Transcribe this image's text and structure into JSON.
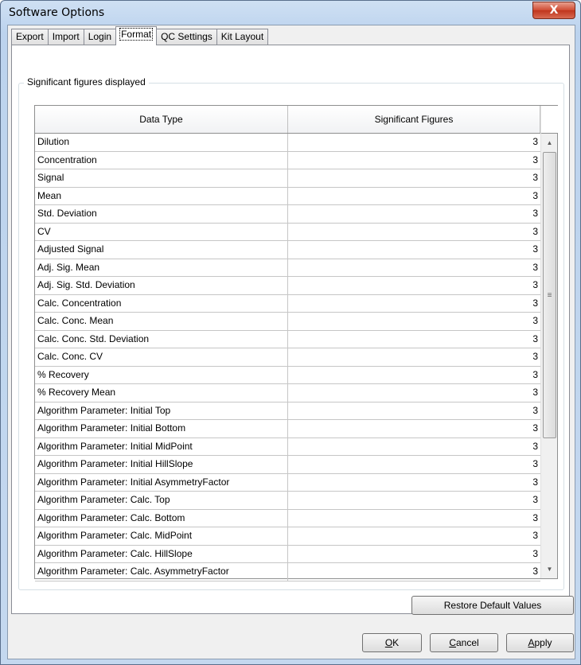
{
  "window": {
    "title": "Software Options",
    "close_label": "X"
  },
  "tabs": [
    {
      "label": "Export"
    },
    {
      "label": "Import"
    },
    {
      "label": "Login"
    },
    {
      "label": "Format"
    },
    {
      "label": "QC Settings"
    },
    {
      "label": "Kit Layout"
    }
  ],
  "active_tab": "Format",
  "group": {
    "label": "Significant figures displayed"
  },
  "grid": {
    "columns": [
      "Data Type",
      "Significant Figures"
    ],
    "rows": [
      {
        "data_type": "Dilution",
        "sig_figs": "3"
      },
      {
        "data_type": "Concentration",
        "sig_figs": "3"
      },
      {
        "data_type": "Signal",
        "sig_figs": "3"
      },
      {
        "data_type": "Mean",
        "sig_figs": "3"
      },
      {
        "data_type": "Std. Deviation",
        "sig_figs": "3"
      },
      {
        "data_type": "CV",
        "sig_figs": "3"
      },
      {
        "data_type": "Adjusted Signal",
        "sig_figs": "3"
      },
      {
        "data_type": "Adj. Sig. Mean",
        "sig_figs": "3"
      },
      {
        "data_type": "Adj. Sig. Std. Deviation",
        "sig_figs": "3"
      },
      {
        "data_type": "Calc. Concentration",
        "sig_figs": "3"
      },
      {
        "data_type": "Calc. Conc. Mean",
        "sig_figs": "3"
      },
      {
        "data_type": "Calc. Conc. Std. Deviation",
        "sig_figs": "3"
      },
      {
        "data_type": "Calc. Conc. CV",
        "sig_figs": "3"
      },
      {
        "data_type": "% Recovery",
        "sig_figs": "3"
      },
      {
        "data_type": "% Recovery Mean",
        "sig_figs": "3"
      },
      {
        "data_type": "Algorithm Parameter: Initial Top",
        "sig_figs": "3"
      },
      {
        "data_type": "Algorithm Parameter: Initial Bottom",
        "sig_figs": "3"
      },
      {
        "data_type": "Algorithm Parameter: Initial MidPoint",
        "sig_figs": "3"
      },
      {
        "data_type": "Algorithm Parameter: Initial HillSlope",
        "sig_figs": "3"
      },
      {
        "data_type": "Algorithm Parameter: Initial AsymmetryFactor",
        "sig_figs": "3"
      },
      {
        "data_type": "Algorithm Parameter: Calc. Top",
        "sig_figs": "3"
      },
      {
        "data_type": "Algorithm Parameter: Calc. Bottom",
        "sig_figs": "3"
      },
      {
        "data_type": "Algorithm Parameter: Calc. MidPoint",
        "sig_figs": "3"
      },
      {
        "data_type": "Algorithm Parameter: Calc. HillSlope",
        "sig_figs": "3"
      },
      {
        "data_type": "Algorithm Parameter: Calc. AsymmetryFactor",
        "sig_figs": "3"
      }
    ]
  },
  "scrollbar": {
    "up_icon": "scroll-up-arrow-icon",
    "down_icon": "scroll-down-arrow-icon",
    "grip_icon": "scroll-grip-icon"
  },
  "buttons": {
    "restore_defaults": "Restore Default Values",
    "ok": {
      "underlined": "O",
      "rest": "K"
    },
    "cancel": {
      "underlined": "C",
      "rest": "ancel"
    },
    "apply": {
      "underlined": "A",
      "rest": "pply"
    }
  }
}
